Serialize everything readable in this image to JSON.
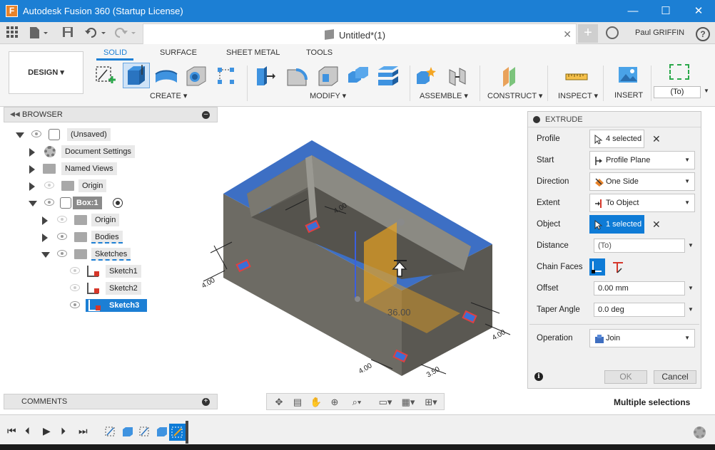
{
  "window": {
    "title": "Autodesk Fusion 360 (Startup License)",
    "app_icon_letter": "F",
    "minimize": "—",
    "maximize": "☐",
    "close": "✕"
  },
  "quickbar": {
    "document_title": "Untitled*(1)",
    "close_tab": "✕",
    "new_tab": "+",
    "user_name": "Paul GRIFFIN",
    "help": "?"
  },
  "ribbon": {
    "workspace": "DESIGN ▾",
    "tabs": [
      "SOLID",
      "SURFACE",
      "SHEET METAL",
      "TOOLS"
    ],
    "active_tab": "SOLID",
    "groups": [
      "CREATE ▾",
      "MODIFY ▾",
      "ASSEMBLE ▾",
      "CONSTRUCT ▾",
      "INSPECT ▾",
      "INSERT"
    ],
    "select_value": "(To)"
  },
  "browser": {
    "title": "BROWSER",
    "items": [
      {
        "label": "(Unsaved)"
      },
      {
        "label": "Document Settings"
      },
      {
        "label": "Named Views"
      },
      {
        "label": "Origin"
      },
      {
        "label": "Box:1"
      },
      {
        "label": "Origin"
      },
      {
        "label": "Bodies"
      },
      {
        "label": "Sketches"
      },
      {
        "label": "Sketch1"
      },
      {
        "label": "Sketch2"
      },
      {
        "label": "Sketch3"
      }
    ]
  },
  "viewport": {
    "dimension_label": "36.00",
    "dim_labels": [
      "4.00",
      "4.00",
      "4.00",
      "3.50",
      "4.00"
    ]
  },
  "extrude": {
    "title": "EXTRUDE",
    "rows": {
      "profile_label": "Profile",
      "profile_value": "4 selected",
      "start_label": "Start",
      "start_value": "Profile Plane",
      "direction_label": "Direction",
      "direction_value": "One Side",
      "extent_label": "Extent",
      "extent_value": "To Object",
      "object_label": "Object",
      "object_value": "1 selected",
      "distance_label": "Distance",
      "distance_value": "(To)",
      "chain_label": "Chain Faces",
      "offset_label": "Offset",
      "offset_value": "0.00 mm",
      "taper_label": "Taper Angle",
      "taper_value": "0.0 deg",
      "operation_label": "Operation",
      "operation_value": "Join"
    },
    "ok": "OK",
    "cancel": "Cancel",
    "info": "i"
  },
  "status": {
    "multiple_selections": "Multiple selections"
  },
  "comments": {
    "title": "COMMENTS"
  },
  "colors": {
    "accent": "#1c7fd4",
    "selection_blue": "#0e7bd6",
    "model_top": "#3d6fc4",
    "model_side": "#6d6b64",
    "preview_orange": "#e8a21f"
  }
}
